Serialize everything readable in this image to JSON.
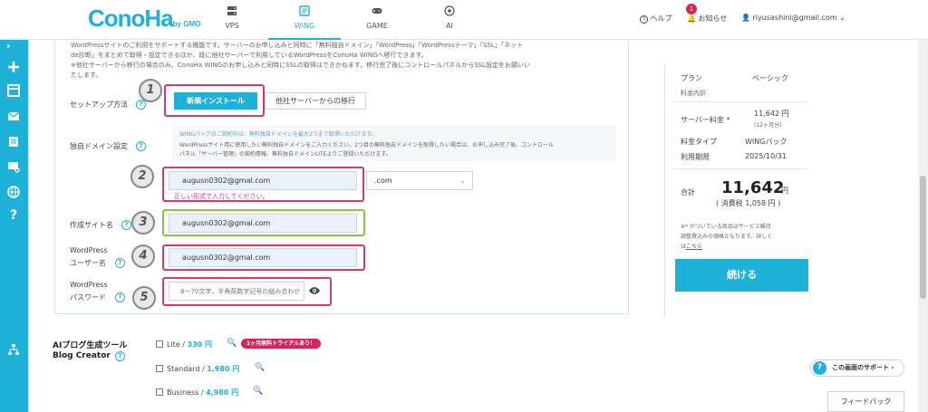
{
  "header": {
    "logo": "ConoHa",
    "logo_sub": "by GMO",
    "tabs": [
      {
        "label": "VPS"
      },
      {
        "label": "WING"
      },
      {
        "label": "GAME"
      },
      {
        "label": "AI"
      }
    ],
    "help_label": "ヘルプ",
    "notifications_label": "お知らせ",
    "notifications_count": "1",
    "user_email": "riyusashini@gmail.com"
  },
  "intro": {
    "line1": "WordPressサイトのご利用をサポートする機能です。サーバーのお申し込みと同時に「無料独自ドメイン」「WordPress」「WordPressテーマ」「SSL」「ネット",
    "line2": "de診断」をまとめて取得・設定できるほか、既に他社サーバーで利用しているWordPressをConoHa WINGへ移行できます。",
    "line3": "※他社サーバーから移行の場合のみ、ConoHa WINGのお申し込みと同時にSSLの取得はできかねます。移行完了後にコントロールパネルからSSL設定をお願いい",
    "line4": "たします。"
  },
  "setup": {
    "label": "セットアップ方法",
    "new_install": "新規インストール",
    "migrate": "他社サーバーからの移行"
  },
  "domain": {
    "label": "独自ドメイン設定",
    "note1": "WINGパックのご契約中は、無料独自ドメインを最大2つまで取得いただけます。",
    "note2": "WordPressサイト用に使用したい無料独自ドメインをご入力ください。2つ目の無料独自ドメインを取得したい場合は、お申し込み完了後、コントロール",
    "note3": "パネル「サーバー管理」の契約情報、無料独自ドメインLITEよりご登録いただけます。",
    "value": "augusn0302@gmal.com",
    "error": "正しい形式で入力してください。",
    "tld": ".com"
  },
  "site_name": {
    "label": "作成サイト名",
    "value": "augusn0302@gmal.com"
  },
  "wp_user": {
    "label1": "WordPress",
    "label2": "ユーザー名",
    "value": "augusn0302@gmal.com"
  },
  "wp_pass": {
    "label1": "WordPress",
    "label2": "パスワード",
    "placeholder": "8～70文字、半角英数字記号の組み合わせ"
  },
  "markers": [
    "1",
    "2",
    "3",
    "4",
    "5"
  ],
  "ai_tool": {
    "title1": "AIブログ生成ツール",
    "title2": "Blog Creator",
    "plans": [
      {
        "name": "Lite / ",
        "price": "330 円"
      },
      {
        "name": "Standard / ",
        "price": "1,980 円"
      },
      {
        "name": "Business / ",
        "price": "4,980 円"
      }
    ],
    "trial_badge": "1ヶ月無料トライアルあり！"
  },
  "summary": {
    "plan_label": "プラン",
    "plan_value": "ベーシック",
    "fee_details": "料金内訳",
    "server_fee_label": "サーバー料金 *",
    "server_fee_value": "11,642 円",
    "server_fee_period": "(12ヶ月分)",
    "fee_type_label": "料金タイプ",
    "fee_type_value": "WINGパック",
    "expiry_label": "利用期限",
    "expiry_value": "2025/10/31",
    "total_label": "合計",
    "total_value": "11,642",
    "total_unit": "円",
    "tax_note": "( 消費税 1,058 円 )",
    "footnote1": "※* がついている商品はサービス維持",
    "footnote2": "調整費込みの価格となります。詳しく",
    "footnote3_prefix": "は",
    "footnote3_link": "こちら",
    "continue": "続ける"
  },
  "support_button": "この画面のサポート",
  "feedback_button": "フィードバック",
  "colors": {
    "accent": "#1fb2d8",
    "highlight_red": "#d63a6a",
    "highlight_green": "#8cc63f",
    "badge_pink": "#d6245c",
    "link_blue": "#1a7fc0"
  }
}
